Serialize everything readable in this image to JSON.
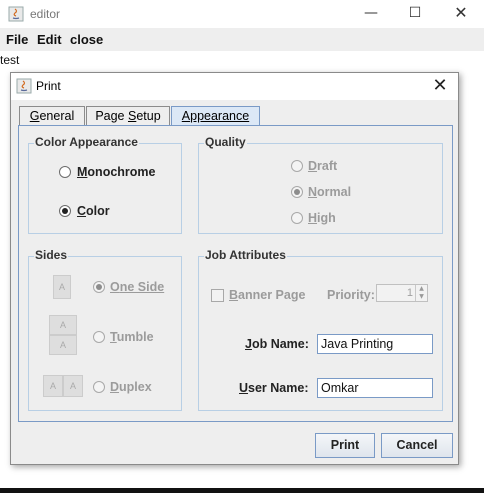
{
  "window": {
    "title": "editor",
    "minimize_glyph": "—",
    "maximize_glyph": "☐",
    "close_glyph": "✕"
  },
  "menu": {
    "items": [
      "File",
      "Edit",
      "close"
    ]
  },
  "editor": {
    "text": "test"
  },
  "dialog": {
    "title": "Print",
    "close_glyph": "✕",
    "tabs": [
      {
        "label": "General",
        "mnemonic": "G",
        "rest": "eneral",
        "active": false
      },
      {
        "label": "Page Setup",
        "before": "Page ",
        "mnemonic": "S",
        "rest": "etup",
        "active": false
      },
      {
        "label": "Appearance",
        "mnemonic": "A",
        "rest": "ppearance",
        "active": true
      }
    ],
    "color_appearance": {
      "title": "Color Appearance",
      "options": [
        {
          "label": "Monochrome",
          "mnemonic": "M",
          "rest": "onochrome",
          "selected": false
        },
        {
          "label": "Color",
          "mnemonic": "C",
          "rest": "olor",
          "selected": true
        }
      ]
    },
    "quality": {
      "title": "Quality",
      "enabled": false,
      "options": [
        {
          "label": "Draft",
          "mnemonic": "D",
          "rest": "raft",
          "selected": false
        },
        {
          "label": "Normal",
          "mnemonic": "N",
          "rest": "ormal",
          "selected": true
        },
        {
          "label": "High",
          "mnemonic": "H",
          "rest": "igh",
          "selected": false
        }
      ]
    },
    "sides": {
      "title": "Sides",
      "enabled": false,
      "icon_letter": "A",
      "options": [
        {
          "label": "One Side",
          "mnemonic": "O",
          "rest": "ne Side",
          "selected": true
        },
        {
          "label": "Tumble",
          "mnemonic": "T",
          "rest": "umble",
          "selected": false
        },
        {
          "label": "Duplex",
          "mnemonic": "D",
          "rest": "uplex",
          "selected": false
        }
      ]
    },
    "job_attributes": {
      "title": "Job Attributes",
      "banner_page": {
        "label": "Banner Page",
        "mnemonic": "B",
        "rest": "anner Page",
        "checked": false,
        "enabled": false
      },
      "priority": {
        "label": "Priority:",
        "mnemonic": "r",
        "value": "1",
        "enabled": false
      },
      "job_name": {
        "label": "Job Name:",
        "mnemonic": "J",
        "rest": "ob Name:",
        "value": "Java Printing"
      },
      "user_name": {
        "label": "User Name:",
        "mnemonic": "U",
        "rest": "ser Name:",
        "value": "Omkar"
      }
    },
    "buttons": {
      "print": "Print",
      "cancel": "Cancel"
    }
  }
}
